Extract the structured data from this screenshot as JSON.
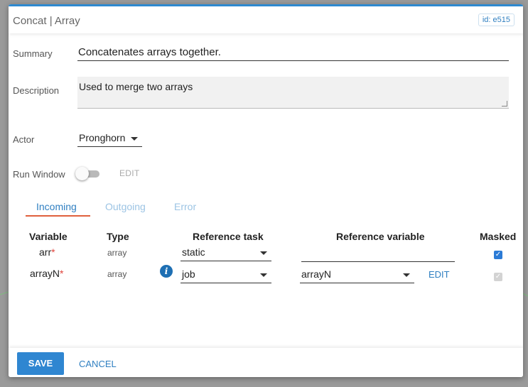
{
  "dialog": {
    "title": "Concat | Array",
    "id_badge": "id: e515",
    "accent_color": "#2f8ad1"
  },
  "form": {
    "summary_label": "Summary",
    "summary_value": "Concatenates arrays together.",
    "description_label": "Description",
    "description_value": "Used to merge two arrays",
    "actor_label": "Actor",
    "actor_value": "Pronghorn",
    "run_window_label": "Run Window",
    "run_window_enabled": false,
    "run_window_edit": "EDIT"
  },
  "tabs": [
    {
      "label": "Incoming",
      "active": true
    },
    {
      "label": "Outgoing",
      "active": false
    },
    {
      "label": "Error",
      "active": false
    }
  ],
  "table": {
    "headers": {
      "variable": "Variable",
      "type": "Type",
      "reference_task": "Reference task",
      "reference_variable": "Reference variable",
      "masked": "Masked"
    },
    "rows": [
      {
        "variable": "arr",
        "required": "*",
        "type": "array",
        "reference_task": "static",
        "reference_variable": "",
        "masked": true,
        "masked_disabled": false
      },
      {
        "variable": "arrayN",
        "required": "*",
        "type": "array",
        "reference_task": "job",
        "reference_variable": "arrayN",
        "edit": "EDIT",
        "masked": true,
        "masked_disabled": true
      }
    ]
  },
  "footer": {
    "save_label": "SAVE",
    "cancel_label": "CANCEL"
  },
  "icons": {
    "info": "info-icon",
    "caret": "chevron-down-icon",
    "check": "check-icon"
  }
}
